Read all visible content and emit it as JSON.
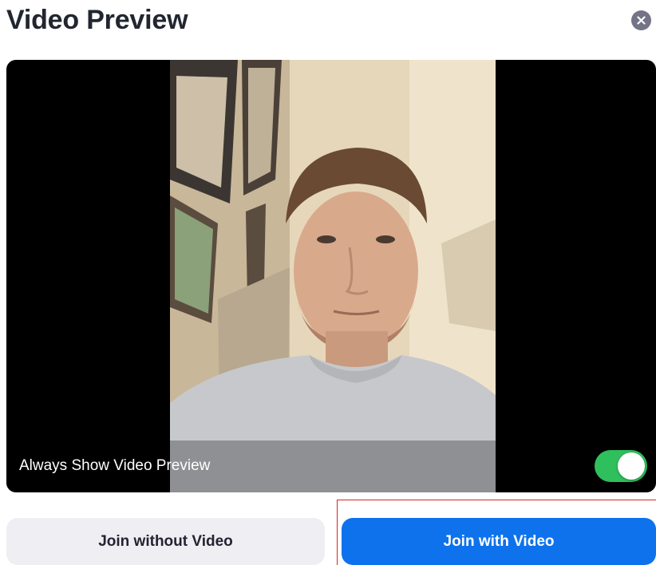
{
  "dialog": {
    "title": "Video Preview",
    "close_icon": "close-icon"
  },
  "preview": {
    "always_show_label": "Always Show Video Preview",
    "toggle_on": true,
    "toggle_color": "#2fbf5c"
  },
  "buttons": {
    "join_without_video": "Join without Video",
    "join_with_video": "Join with Video",
    "primary_color": "#0e72ed"
  }
}
